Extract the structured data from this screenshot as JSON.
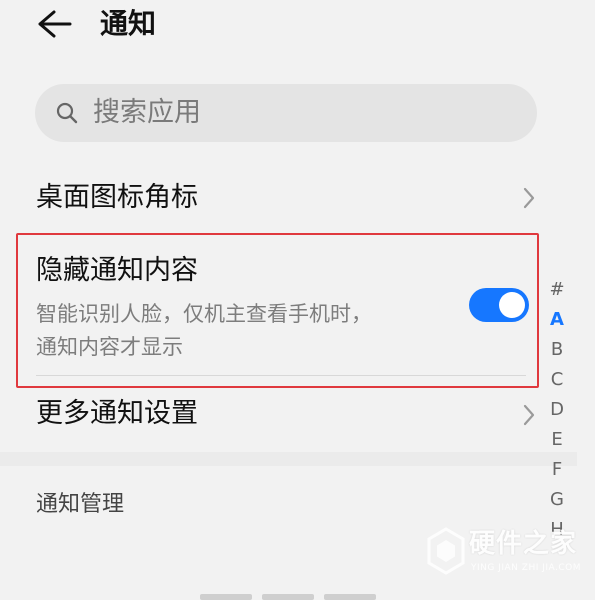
{
  "header": {
    "back_icon": "arrow-left-icon",
    "title": "通知"
  },
  "search": {
    "icon": "search-icon",
    "placeholder": "搜索应用"
  },
  "rows": {
    "badge": {
      "label": "桌面图标角标",
      "icon": "chevron-right-icon"
    },
    "hide_content": {
      "label": "隐藏通知内容",
      "description_line1": "智能识别人脸，仅机主查看手机时，",
      "description_line2": "通知内容才显示",
      "toggle_on": true
    },
    "more": {
      "label": "更多通知设置",
      "icon": "chevron-right-icon"
    }
  },
  "section": {
    "title": "通知管理"
  },
  "alpha_index": {
    "letters": [
      "#",
      "A",
      "B",
      "C",
      "D",
      "E",
      "F",
      "G",
      "H"
    ],
    "active": "A"
  },
  "watermark": {
    "title": "硬件之家",
    "subtitle": "YING JIAN ZHI JIA.COM"
  },
  "colors": {
    "accent": "#1677ff",
    "highlight_border": "#e0393e",
    "background": "#f2f2f2",
    "search_bg": "#e4e4e4"
  }
}
